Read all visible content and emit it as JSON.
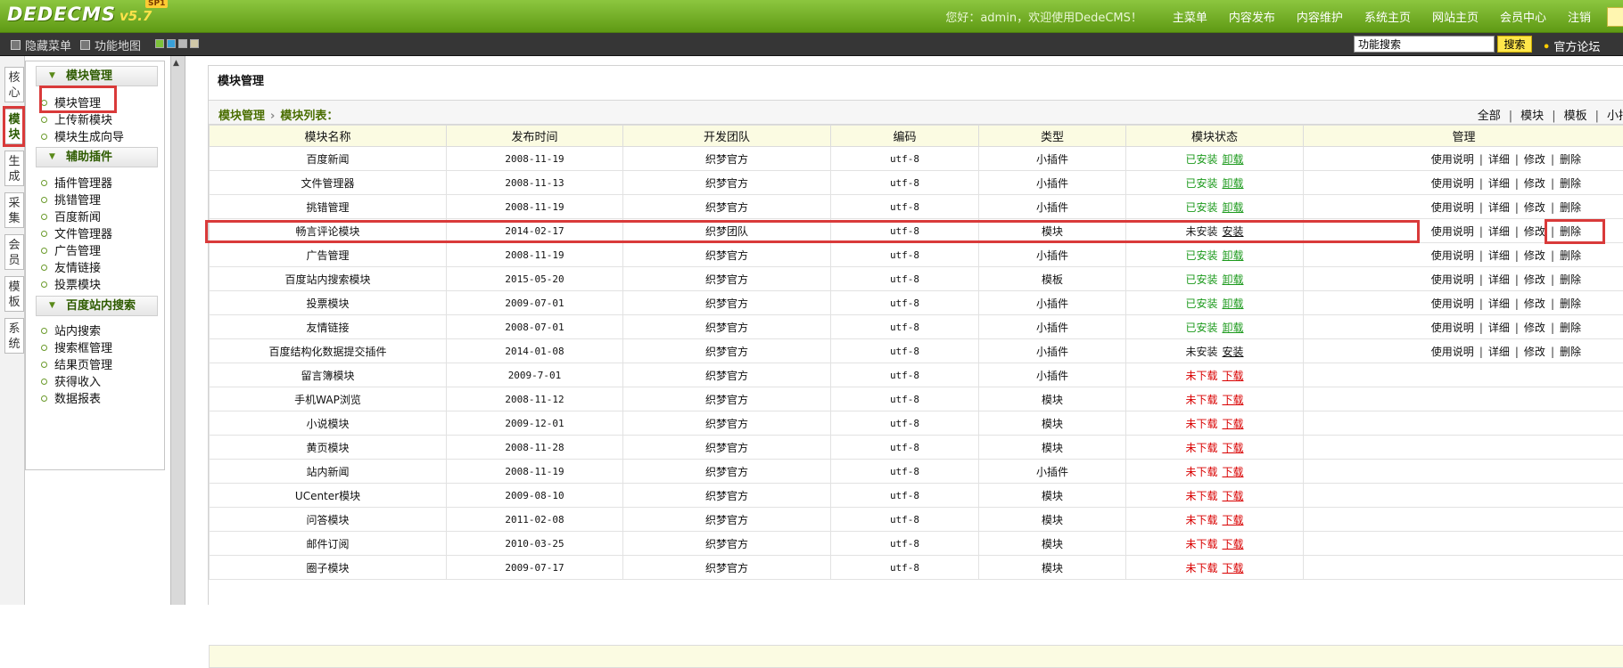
{
  "header": {
    "logo_text": "DEDECMS",
    "logo_version": "v5.7",
    "logo_badge": "SP1",
    "welcome": "您好：admin，欢迎使用DedeCMS！",
    "nav": [
      "主菜单",
      "内容发布",
      "内容维护",
      "系统主页",
      "网站主页",
      "会员中心",
      "注销"
    ]
  },
  "toolbar": {
    "hide_menu": "隐藏菜单",
    "func_map": "功能地图",
    "search_value": "功能搜索",
    "search_button": "搜索",
    "forum": "官方论坛",
    "skin_colors": [
      "#7cc13a",
      "#3aa0d8",
      "#b8b8b8",
      "#d0c8a8"
    ]
  },
  "left_tabs": [
    "核心",
    "模块",
    "生成",
    "采集",
    "会员",
    "模板",
    "系统"
  ],
  "menu": {
    "sections": [
      {
        "title": "模块管理",
        "items": [
          "模块管理",
          "上传新模块",
          "模块生成向导"
        ]
      },
      {
        "title": "辅助插件",
        "items": [
          "插件管理器",
          "挑错管理",
          "百度新闻",
          "文件管理器",
          "广告管理",
          "友情链接",
          "投票模块"
        ]
      },
      {
        "title": "百度站内搜索",
        "items": [
          "站内搜索",
          "搜索框管理",
          "结果页管理",
          "获得收入",
          "数据报表"
        ]
      }
    ]
  },
  "main": {
    "page_title": "模块管理",
    "breadcrumb": [
      "模块管理",
      "模块列表："
    ],
    "filters": [
      "全部",
      "模块",
      "模板",
      "小插件"
    ],
    "columns": [
      "模块名称",
      "发布时间",
      "开发团队",
      "编码",
      "类型",
      "模块状态",
      "管理"
    ],
    "rows": [
      {
        "name": "百度新闻",
        "date": "2008-11-19",
        "team": "织梦官方",
        "enc": "utf-8",
        "type": "小插件",
        "status": "已安装",
        "action": "卸载",
        "kind": "installed"
      },
      {
        "name": "文件管理器",
        "date": "2008-11-13",
        "team": "织梦官方",
        "enc": "utf-8",
        "type": "小插件",
        "status": "已安装",
        "action": "卸载",
        "kind": "installed"
      },
      {
        "name": "挑错管理",
        "date": "2008-11-19",
        "team": "织梦官方",
        "enc": "utf-8",
        "type": "小插件",
        "status": "已安装",
        "action": "卸载",
        "kind": "installed"
      },
      {
        "name": "畅言评论模块",
        "date": "2014-02-17",
        "team": "织梦团队",
        "enc": "utf-8",
        "type": "模块",
        "status": "未安装",
        "action": "安装",
        "kind": "notinstalled"
      },
      {
        "name": "广告管理",
        "date": "2008-11-19",
        "team": "织梦官方",
        "enc": "utf-8",
        "type": "小插件",
        "status": "已安装",
        "action": "卸载",
        "kind": "installed"
      },
      {
        "name": "百度站内搜索模块",
        "date": "2015-05-20",
        "team": "织梦官方",
        "enc": "utf-8",
        "type": "模板",
        "status": "已安装",
        "action": "卸载",
        "kind": "installed"
      },
      {
        "name": "投票模块",
        "date": "2009-07-01",
        "team": "织梦官方",
        "enc": "utf-8",
        "type": "小插件",
        "status": "已安装",
        "action": "卸载",
        "kind": "installed"
      },
      {
        "name": "友情链接",
        "date": "2008-07-01",
        "team": "织梦官方",
        "enc": "utf-8",
        "type": "小插件",
        "status": "已安装",
        "action": "卸载",
        "kind": "installed"
      },
      {
        "name": "百度结构化数据提交插件",
        "date": "2014-01-08",
        "team": "织梦官方",
        "enc": "utf-8",
        "type": "小插件",
        "status": "未安装",
        "action": "安装",
        "kind": "notinstalled"
      },
      {
        "name": "留言簿模块",
        "date": "2009-7-01",
        "team": "织梦官方",
        "enc": "utf-8",
        "type": "小插件",
        "status": "未下载",
        "action": "下载",
        "kind": "notdownloaded"
      },
      {
        "name": "手机WAP浏览",
        "date": "2008-11-12",
        "team": "织梦官方",
        "enc": "utf-8",
        "type": "模块",
        "status": "未下载",
        "action": "下载",
        "kind": "notdownloaded"
      },
      {
        "name": "小说模块",
        "date": "2009-12-01",
        "team": "织梦官方",
        "enc": "utf-8",
        "type": "模块",
        "status": "未下载",
        "action": "下载",
        "kind": "notdownloaded"
      },
      {
        "name": "黄页模块",
        "date": "2008-11-28",
        "team": "织梦官方",
        "enc": "utf-8",
        "type": "模块",
        "status": "未下载",
        "action": "下载",
        "kind": "notdownloaded"
      },
      {
        "name": "站内新闻",
        "date": "2008-11-19",
        "team": "织梦官方",
        "enc": "utf-8",
        "type": "小插件",
        "status": "未下载",
        "action": "下载",
        "kind": "notdownloaded"
      },
      {
        "name": "UCenter模块",
        "date": "2009-08-10",
        "team": "织梦官方",
        "enc": "utf-8",
        "type": "模块",
        "status": "未下载",
        "action": "下载",
        "kind": "notdownloaded"
      },
      {
        "name": "问答模块",
        "date": "2011-02-08",
        "team": "织梦官方",
        "enc": "utf-8",
        "type": "模块",
        "status": "未下载",
        "action": "下载",
        "kind": "notdownloaded"
      },
      {
        "name": "邮件订阅",
        "date": "2010-03-25",
        "team": "织梦官方",
        "enc": "utf-8",
        "type": "模块",
        "status": "未下载",
        "action": "下载",
        "kind": "notdownloaded"
      },
      {
        "name": "圈子模块",
        "date": "2009-07-17",
        "team": "织梦官方",
        "enc": "utf-8",
        "type": "模块",
        "status": "未下载",
        "action": "下载",
        "kind": "notdownloaded"
      }
    ],
    "manage_actions": [
      "使用说明",
      "详细",
      "修改",
      "删除"
    ]
  }
}
